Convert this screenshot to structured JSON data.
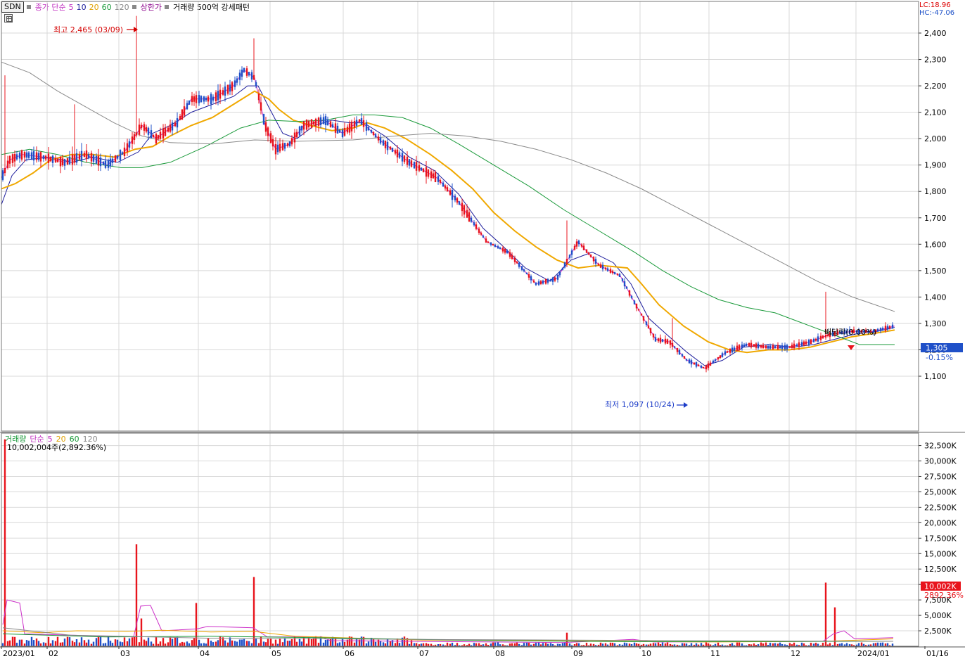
{
  "header": {
    "symbol": "SDN",
    "price_legend": {
      "label": "종가 단순",
      "periods": [
        "5",
        "10",
        "20",
        "60",
        "120"
      ]
    },
    "limit_label": "상한가",
    "pattern_label": "거래량 500억 강세패턴"
  },
  "axis_info": {
    "lc": "LC:18.96",
    "hc": "HC:-47.06"
  },
  "volume_panel": {
    "legend": {
      "label": "거래량",
      "ma_label": "단순",
      "periods": [
        "5",
        "20",
        "60",
        "120"
      ]
    },
    "peak_label": "10,002,004주(2,892.36%)"
  },
  "colors": {
    "up": "#e8141c",
    "down": "#1f50c8",
    "ma5": "#cc2ec8",
    "ma10": "#1c1c9c",
    "ma20": "#f0a800",
    "ma60": "#1a9a3a",
    "ma120": "#8a8a8a"
  },
  "chart_data": [
    {
      "type": "candlestick",
      "title": "SDN",
      "y_ticks": [
        "1,100",
        "1,200",
        "1,300",
        "1,400",
        "1,500",
        "1,600",
        "1,700",
        "1,800",
        "1,900",
        "2,000",
        "2,100",
        "2,200",
        "2,300",
        "2,400"
      ],
      "ylim": [
        1000,
        2500
      ],
      "x_ticks": [
        "2023/01",
        "02",
        "03",
        "04",
        "05",
        "06",
        "07",
        "08",
        "09",
        "10",
        "11",
        "12",
        "2024/01",
        "01/16"
      ],
      "current_price": "1,305",
      "current_change": "-0.15%",
      "annotations": {
        "high": "최고 2,465 (03/09)",
        "low": "최저 1,097 (10/24)",
        "dividend": "배당락(0.00%)"
      },
      "series": [
        {
          "name": "5",
          "anchors": [
            [
              0,
              1850
            ],
            [
              12,
              1920
            ],
            [
              30,
              1940
            ],
            [
              60,
              1930
            ],
            [
              90,
              1910
            ],
            [
              120,
              1940
            ],
            [
              150,
              1900
            ],
            [
              175,
              1950
            ],
            [
              200,
              2050
            ],
            [
              220,
              2000
            ],
            [
              250,
              2060
            ],
            [
              270,
              2150
            ],
            [
              300,
              2150
            ],
            [
              330,
              2200
            ],
            [
              345,
              2260
            ],
            [
              360,
              2230
            ],
            [
              375,
              2050
            ],
            [
              390,
              1960
            ],
            [
              410,
              1980
            ],
            [
              430,
              2050
            ],
            [
              460,
              2070
            ],
            [
              485,
              2020
            ],
            [
              510,
              2070
            ],
            [
              540,
              1990
            ],
            [
              580,
              1910
            ],
            [
              620,
              1850
            ],
            [
              650,
              1760
            ],
            [
              690,
              1610
            ],
            [
              720,
              1570
            ],
            [
              760,
              1450
            ],
            [
              790,
              1470
            ],
            [
              820,
              1610
            ],
            [
              850,
              1520
            ],
            [
              880,
              1480
            ],
            [
              900,
              1380
            ],
            [
              930,
              1240
            ],
            [
              950,
              1230
            ],
            [
              975,
              1160
            ],
            [
              1000,
              1130
            ],
            [
              1030,
              1190
            ],
            [
              1060,
              1220
            ],
            [
              1090,
              1210
            ],
            [
              1120,
              1210
            ],
            [
              1150,
              1230
            ],
            [
              1180,
              1260
            ],
            [
              1210,
              1270
            ],
            [
              1240,
              1270
            ],
            [
              1270,
              1290
            ]
          ]
        },
        {
          "name": "10",
          "anchors": [
            [
              0,
              1750
            ],
            [
              15,
              1860
            ],
            [
              35,
              1920
            ],
            [
              70,
              1930
            ],
            [
              100,
              1910
            ],
            [
              130,
              1930
            ],
            [
              165,
              1910
            ],
            [
              195,
              1950
            ],
            [
              215,
              2020
            ],
            [
              240,
              2050
            ],
            [
              270,
              2100
            ],
            [
              300,
              2130
            ],
            [
              330,
              2160
            ],
            [
              350,
              2200
            ],
            [
              365,
              2200
            ],
            [
              380,
              2120
            ],
            [
              400,
              2020
            ],
            [
              420,
              2000
            ],
            [
              445,
              2050
            ],
            [
              470,
              2070
            ],
            [
              495,
              2060
            ],
            [
              515,
              2060
            ],
            [
              545,
              2010
            ],
            [
              580,
              1930
            ],
            [
              615,
              1880
            ],
            [
              650,
              1790
            ],
            [
              685,
              1660
            ],
            [
              710,
              1600
            ],
            [
              745,
              1510
            ],
            [
              780,
              1460
            ],
            [
              810,
              1540
            ],
            [
              840,
              1570
            ],
            [
              870,
              1530
            ],
            [
              895,
              1450
            ],
            [
              920,
              1320
            ],
            [
              945,
              1260
            ],
            [
              975,
              1190
            ],
            [
              1000,
              1140
            ],
            [
              1025,
              1160
            ],
            [
              1055,
              1210
            ],
            [
              1090,
              1220
            ],
            [
              1125,
              1210
            ],
            [
              1155,
              1220
            ],
            [
              1185,
              1240
            ],
            [
              1215,
              1260
            ],
            [
              1245,
              1270
            ],
            [
              1270,
              1285
            ]
          ]
        },
        {
          "name": "20",
          "anchors": [
            [
              0,
              1810
            ],
            [
              20,
              1830
            ],
            [
              45,
              1870
            ],
            [
              70,
              1920
            ],
            [
              100,
              1940
            ],
            [
              130,
              1940
            ],
            [
              160,
              1930
            ],
            [
              190,
              1960
            ],
            [
              215,
              1970
            ],
            [
              240,
              2010
            ],
            [
              270,
              2050
            ],
            [
              300,
              2080
            ],
            [
              330,
              2130
            ],
            [
              360,
              2180
            ],
            [
              380,
              2150
            ],
            [
              395,
              2110
            ],
            [
              415,
              2070
            ],
            [
              440,
              2050
            ],
            [
              470,
              2030
            ],
            [
              500,
              2040
            ],
            [
              520,
              2060
            ],
            [
              545,
              2040
            ],
            [
              575,
              2000
            ],
            [
              610,
              1940
            ],
            [
              640,
              1880
            ],
            [
              670,
              1810
            ],
            [
              700,
              1720
            ],
            [
              730,
              1650
            ],
            [
              760,
              1590
            ],
            [
              790,
              1540
            ],
            [
              820,
              1510
            ],
            [
              850,
              1520
            ],
            [
              890,
              1510
            ],
            [
              910,
              1450
            ],
            [
              935,
              1370
            ],
            [
              970,
              1290
            ],
            [
              1005,
              1230
            ],
            [
              1035,
              1200
            ],
            [
              1060,
              1190
            ],
            [
              1090,
              1200
            ],
            [
              1120,
              1200
            ],
            [
              1150,
              1210
            ],
            [
              1180,
              1230
            ],
            [
              1210,
              1250
            ],
            [
              1240,
              1262
            ],
            [
              1270,
              1275
            ]
          ]
        },
        {
          "name": "60",
          "anchors": [
            [
              0,
              1940
            ],
            [
              40,
              1960
            ],
            [
              80,
              1940
            ],
            [
              120,
              1910
            ],
            [
              170,
              1890
            ],
            [
              200,
              1890
            ],
            [
              240,
              1910
            ],
            [
              290,
              1970
            ],
            [
              340,
              2040
            ],
            [
              380,
              2070
            ],
            [
              420,
              2065
            ],
            [
              460,
              2070
            ],
            [
              500,
              2090
            ],
            [
              530,
              2090
            ],
            [
              570,
              2080
            ],
            [
              610,
              2040
            ],
            [
              650,
              1980
            ],
            [
              700,
              1900
            ],
            [
              750,
              1820
            ],
            [
              800,
              1730
            ],
            [
              850,
              1650
            ],
            [
              900,
              1570
            ],
            [
              940,
              1500
            ],
            [
              980,
              1440
            ],
            [
              1020,
              1390
            ],
            [
              1060,
              1360
            ],
            [
              1100,
              1340
            ],
            [
              1140,
              1300
            ],
            [
              1180,
              1260
            ],
            [
              1220,
              1220
            ],
            [
              1270,
              1220
            ]
          ]
        },
        {
          "name": "120",
          "anchors": [
            [
              0,
              2290
            ],
            [
              40,
              2250
            ],
            [
              80,
              2180
            ],
            [
              120,
              2120
            ],
            [
              160,
              2060
            ],
            [
              200,
              2010
            ],
            [
              240,
              1985
            ],
            [
              300,
              1980
            ],
            [
              360,
              1995
            ],
            [
              420,
              1990
            ],
            [
              500,
              1995
            ],
            [
              560,
              2010
            ],
            [
              610,
              2020
            ],
            [
              660,
              2010
            ],
            [
              710,
              1990
            ],
            [
              760,
              1960
            ],
            [
              810,
              1920
            ],
            [
              860,
              1870
            ],
            [
              910,
              1810
            ],
            [
              960,
              1740
            ],
            [
              1010,
              1670
            ],
            [
              1060,
              1600
            ],
            [
              1110,
              1530
            ],
            [
              1160,
              1460
            ],
            [
              1210,
              1400
            ],
            [
              1270,
              1345
            ]
          ]
        }
      ]
    },
    {
      "type": "bar",
      "title": "거래량",
      "y_ticks": [
        "2,500K",
        "5,000K",
        "7,500K",
        "10,000K",
        "12,500K",
        "15,000K",
        "17,500K",
        "20,000K",
        "22,500K",
        "25,000K",
        "27,500K",
        "30,000K",
        "32,500K"
      ],
      "ylim": [
        0,
        34500
      ],
      "current_volume": "10,002K",
      "current_ratio": "2892.36%"
    }
  ]
}
